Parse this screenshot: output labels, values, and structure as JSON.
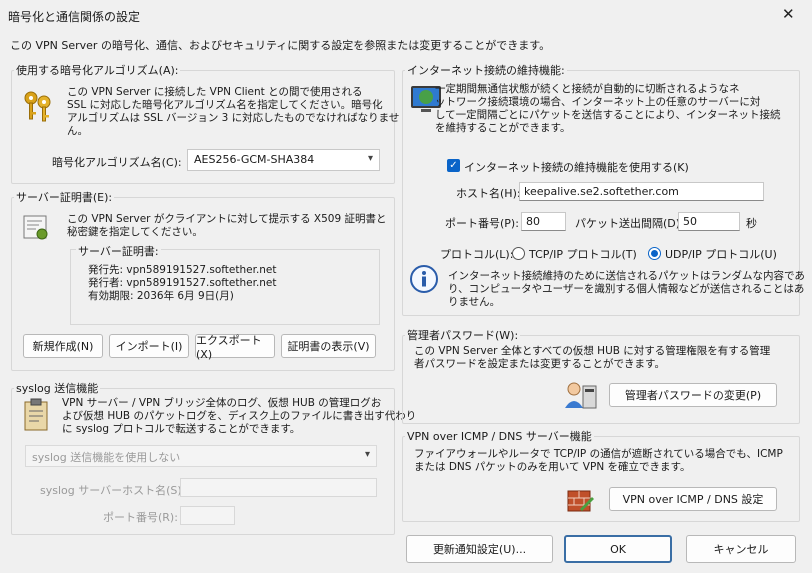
{
  "window": {
    "title": "暗号化と通信関係の設定",
    "close_glyph": "✕"
  },
  "intro": "この VPN Server の暗号化、通信、およびセキュリティに関する設定を参照または変更することができます。",
  "encryption": {
    "legend": "使用する暗号化アルゴリズム(A):",
    "desc1": "この VPN Server に接続した VPN Client との間で使用される",
    "desc2": "SSL に対応した暗号化アルゴリズム名を指定してください。暗号化",
    "desc3": "アルゴリズムは SSL バージョン 3 に対応したものでなければなりませ",
    "desc4": "ん。",
    "label": "暗号化アルゴリズム名(C):",
    "value": "AES256-GCM-SHA384",
    "icon": "keys-icon"
  },
  "certificate": {
    "legend": "サーバー証明書(E):",
    "desc1": "この VPN Server がクライアントに対して提示する X509 証明書と",
    "desc2": "秘密鍵を指定してください。",
    "inner_legend": "サーバー証明書:",
    "issued_to": "発行先: vpn589191527.softether.net",
    "issuer": "発行者: vpn589191527.softether.net",
    "expires": "有効期限: 2036年 6月 9日(月)",
    "buttons": {
      "new": "新規作成(N)",
      "import": "インポート(I)",
      "export": "エクスポート(X)",
      "show": "証明書の表示(V)"
    },
    "icon": "certificate-icon"
  },
  "syslog": {
    "legend": "syslog 送信機能",
    "desc1": "VPN サーバー / VPN ブリッジ全体のログ、仮想 HUB の管理ログお",
    "desc2": "よび仮想 HUB のパケットログを、ディスク上のファイルに書き出す代わり",
    "desc3": "に syslog プロトコルで転送することができます。",
    "select_value": "syslog 送信機能を使用しない",
    "host_label": "syslog サーバーホスト名(S):",
    "port_label": "ポート番号(R):",
    "icon": "clipboard-icon"
  },
  "keepalive": {
    "legend": "インターネット接続の維持機能:",
    "desc1": "一定期間無通信状態が続くと接続が自動的に切断されるようなネ",
    "desc2": "ットワーク接続環境の場合、インターネット上の任意のサーバーに対",
    "desc3": "して一定間隔ごとにパケットを送信することにより、インターネット接続",
    "desc4": "を維持することができます。",
    "checkbox_label": "インターネット接続の維持機能を使用する(K)",
    "host_label": "ホスト名(H):",
    "host_value": "keepalive.se2.softether.com",
    "port_label": "ポート番号(P):",
    "port_value": "80",
    "interval_label": "パケット送出間隔(D):",
    "interval_value": "50",
    "interval_unit": "秒",
    "protocol_label": "プロトコル(L):",
    "tcp_label": "TCP/IP プロトコル(T)",
    "udp_label": "UDP/IP プロトコル(U)",
    "info1": "インターネット接続維持のために送信されるパケットはランダムな内容であ",
    "info2": "り、コンピュータやユーザーを識別する個人情報などが送信されることはあ",
    "info3": "りません。",
    "icon": "globe-icon"
  },
  "admin": {
    "legend": "管理者パスワード(W):",
    "desc1": "この VPN Server 全体とすべての仮想 HUB に対する管理権限を有する管理",
    "desc2": "者パスワードを設定または変更することができます。",
    "button": "管理者パスワードの変更(P)",
    "icon": "admin-user-icon"
  },
  "icmp": {
    "legend": "VPN over ICMP / DNS サーバー機能",
    "desc1": "ファイアウォールやルータで TCP/IP の通信が遮断されている場合でも、ICMP",
    "desc2": "または DNS パケットのみを用いて VPN を確立できます。",
    "button": "VPN over ICMP / DNS 設定",
    "icon": "firewall-icon"
  },
  "footer": {
    "update": "更新通知設定(U)...",
    "ok": "OK",
    "cancel": "キャンセル"
  }
}
